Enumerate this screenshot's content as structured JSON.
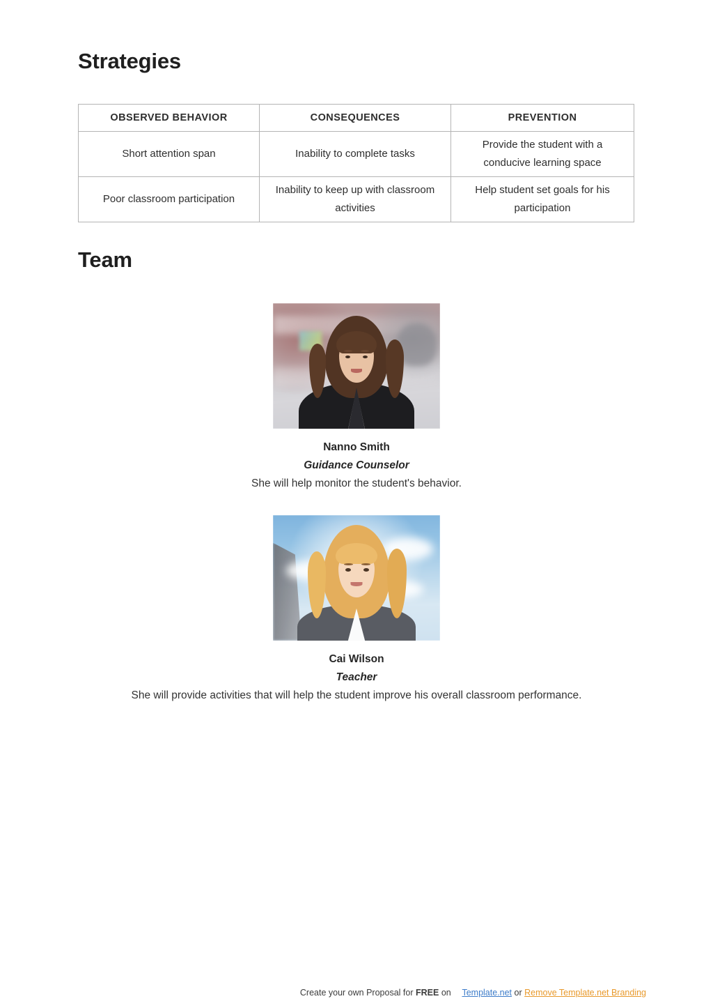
{
  "sections": {
    "strategies_heading": "Strategies",
    "team_heading": "Team"
  },
  "strategies_table": {
    "columns": [
      "OBSERVED BEHAVIOR",
      "CONSEQUENCES",
      "PREVENTION"
    ],
    "rows": [
      {
        "observed_behavior": "Short attention span",
        "consequences": "Inability to complete tasks",
        "prevention": "Provide the student with a conducive learning space"
      },
      {
        "observed_behavior": "Poor classroom participation",
        "consequences": "Inability to keep up with classroom activities",
        "prevention": "Help student set goals for his participation"
      }
    ]
  },
  "team": {
    "members": [
      {
        "name": "Nanno Smith",
        "role": "Guidance Counselor",
        "description": "She will help monitor the student's behavior.",
        "photo": "portrait-photo-brunette-woman-dark-blazer"
      },
      {
        "name": "Cai Wilson",
        "role": "Teacher",
        "description": "She will provide activities that will help the student improve his overall classroom performance.",
        "photo": "portrait-photo-blonde-woman-grey-blazer"
      }
    ]
  },
  "footer": {
    "text_before": "Create your own Proposal for",
    "free_label": "FREE",
    "text_on": "on",
    "template_link": "Template.net",
    "or_label": "or",
    "remove_branding_link": "Remove Template.net Branding"
  },
  "colors": {
    "heading": "#1f1f1f",
    "body_text": "#333333",
    "table_border": "#b4b4b4",
    "link_blue": "#3d7cc9",
    "link_orange": "#e8992b",
    "page_background": "#ffffff"
  }
}
